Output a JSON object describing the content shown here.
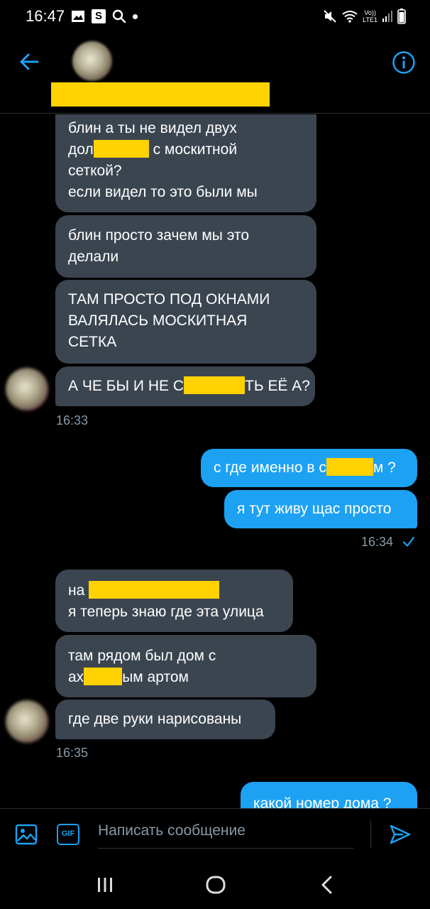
{
  "status_bar": {
    "time": "16:47",
    "left_icons": [
      "image-icon",
      "s-app-icon",
      "search-icon",
      "dot-icon"
    ],
    "right_icons": [
      "mute-icon",
      "wifi-icon",
      "volte-icon",
      "signal-icon",
      "battery-icon"
    ],
    "volte_label": "Vo))",
    "lte_label": "LTE1"
  },
  "header": {
    "back_icon": "arrow-left-icon",
    "info_icon": "info-icon",
    "contact_name_redacted": true
  },
  "messages": [
    {
      "direction": "in",
      "lines": [
        "блин а ты не видел двух",
        "дол",
        " с москитной",
        "сеткой?",
        "если видел то это были мы"
      ]
    },
    {
      "direction": "in",
      "lines": [
        "блин просто зачем мы это",
        "делали"
      ]
    },
    {
      "direction": "in",
      "lines": [
        "ТАМ ПРОСТО ПОД ОКНАМИ",
        "ВАЛЯЛАСЬ МОСКИТНАЯ",
        "СЕТКА"
      ]
    },
    {
      "direction": "in",
      "parts": [
        "А ЧЕ БЫ И НЕ С",
        "ТЬ ЕЁ А?"
      ]
    },
    {
      "time": "16:33"
    },
    {
      "direction": "out",
      "parts": [
        "с где именно в с",
        "м ?"
      ]
    },
    {
      "direction": "out",
      "text": "я тут живу щас просто"
    },
    {
      "time": "16:34",
      "status": "sent"
    },
    {
      "direction": "in",
      "lines": [
        "на",
        "я теперь знаю где эта улица"
      ]
    },
    {
      "direction": "in",
      "lines": [
        "там рядом был дом с",
        "ах",
        "ым артом"
      ]
    },
    {
      "direction": "in",
      "text": "где две руки нарисованы"
    },
    {
      "time": "16:35"
    },
    {
      "direction": "out",
      "text": "какой номер дома ?"
    }
  ],
  "composer": {
    "placeholder": "Написать сообщение",
    "gif_label": "GIF",
    "image_icon": "image-icon",
    "send_icon": "send-icon"
  },
  "nav_bar": {
    "recents_icon": "recents-icon",
    "home_icon": "home-icon",
    "back_icon": "back-chevron-icon"
  },
  "colors": {
    "background": "#000000",
    "incoming_bubble": "#3b4550",
    "outgoing_bubble": "#1da1f2",
    "accent": "#1da1f2",
    "redaction": "#ffd200",
    "muted_text": "#8899a6"
  }
}
